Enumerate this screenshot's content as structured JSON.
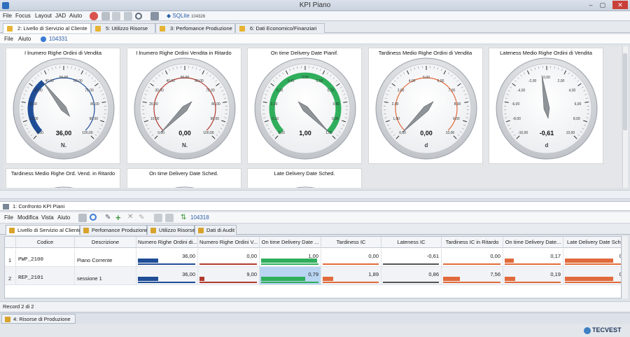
{
  "window": {
    "title": "KPI Piano",
    "min": "–",
    "max": "▢",
    "close": "✕"
  },
  "menubar": {
    "items": [
      "File",
      "Focus",
      "Layout",
      "JAD",
      "Aiuto"
    ],
    "db_label": "SQLite",
    "db_id": "104326"
  },
  "main_tabs": [
    {
      "label": "2: Livello di Servizio al Cliente",
      "active": true
    },
    {
      "label": "5: Utilizzo Risorse",
      "active": false
    },
    {
      "label": "3: Perfomance Produzione",
      "active": false
    },
    {
      "label": "6: Dati Economico/Finanziari",
      "active": false
    }
  ],
  "sub_menu": {
    "items": [
      "File",
      "Aiuto"
    ],
    "db_id": "104331"
  },
  "gauges": [
    {
      "title": "I lnumero Righe Ordini di Vendita",
      "value_text": "36,00",
      "unit": "N.",
      "min": 0,
      "max": 100,
      "value": 36,
      "ticks": [
        "0,00",
        "10,00",
        "20,00",
        "30,00",
        "40,00",
        "50,00",
        "60,00",
        "70,00",
        "80,00",
        "90,00",
        "100,00"
      ],
      "arc": {
        "from": 0,
        "to": 36,
        "color": "#1f4d96",
        "fill_band": true
      },
      "ring": {
        "from": 0,
        "to": 100,
        "color": "#1f4d96"
      }
    },
    {
      "title": "I lnumero Righe Ordini Vendita in Ritardo",
      "value_text": "0,00",
      "unit": "N.",
      "min": 0,
      "max": 100,
      "value": 0,
      "ticks": [
        "0,00",
        "10,00",
        "20,00",
        "30,00",
        "40,00",
        "50,00",
        "60,00",
        "70,00",
        "80,00",
        "90,00",
        "100,00"
      ],
      "arc": null,
      "ring": {
        "from": 0,
        "to": 100,
        "color": "#b03a2e"
      }
    },
    {
      "title": "On time Delivery Date Pianif.",
      "value_text": "1,00",
      "unit": "",
      "min": 0,
      "max": 1,
      "value": 1,
      "ticks": [
        "0,00",
        "0,10",
        "0,20",
        "0,30",
        "0,40",
        "0,50",
        "0,60",
        "0,70",
        "0,80",
        "0,90",
        "1,00"
      ],
      "arc": {
        "from": 0,
        "to": 1,
        "color": "#2fae5b",
        "fill_band": true
      },
      "ring": {
        "from": 0,
        "to": 1,
        "color": "#2fae5b"
      }
    },
    {
      "title": "Tardiness Medio Righe Ordini di Vendita",
      "value_text": "0,00",
      "unit": "d",
      "min": 0,
      "max": 10,
      "value": 0,
      "ticks": [
        "0,00",
        "1,00",
        "2,00",
        "3,00",
        "4,00",
        "5,00",
        "6,00",
        "7,00",
        "8,00",
        "9,00",
        "10,00"
      ],
      "arc": null,
      "ring": {
        "from": 0,
        "to": 10,
        "color": "#e06a3b"
      }
    },
    {
      "title": "Lateness Medio Righe Ordini di Vendita",
      "value_text": "-0,61",
      "unit": "d",
      "min": -10,
      "max": 10,
      "value": -0.61,
      "ticks": [
        "-10,00",
        "-8,00",
        "-6,00",
        "-4,00",
        "-2,00",
        "0,00",
        "2,00",
        "4,00",
        "6,00",
        "8,00",
        "10,00"
      ],
      "arc": null,
      "ring": null
    }
  ],
  "gauges_row2": [
    {
      "title": "Tardiness Medio Righe Ord. Vend. in Ritardo"
    },
    {
      "title": "On time Delivery Date Sched."
    },
    {
      "title": "Late Delivery Date Sched."
    }
  ],
  "lower": {
    "header": "1: Confronto KPI Piani",
    "menu": [
      "File",
      "Modifica",
      "Vista",
      "Aiuto"
    ],
    "db_id": "104318",
    "tabs": [
      {
        "label": "Livello di Servizio al Cliente",
        "active": true
      },
      {
        "label": "Perfomance Produzione",
        "active": false
      },
      {
        "label": "Utilizzo Risorse",
        "active": false
      },
      {
        "label": "Dati di Audit",
        "active": false
      }
    ],
    "columns": [
      "",
      "Codice",
      "Descrizione",
      "Numero Righe Ordini di...",
      "Numero Righe Ordini V...",
      "On time Delivery Date ...",
      "Tardiness IC",
      "Lateness IC",
      "Tardiness IC in Ritardo",
      "On time Delivery Date...",
      "Late Delivery Date Sch..."
    ],
    "rows": [
      {
        "n": "1",
        "codice": "PWP_2100",
        "descrizione": "Piano Corrente",
        "vals": [
          "36,00",
          "0,00",
          "1,00",
          "0,00",
          "-0,61",
          "0,00",
          "0,17",
          "0,8"
        ]
      },
      {
        "n": "2",
        "codice": "REP_2101",
        "descrizione": "sessione 1",
        "vals": [
          "36,00",
          "9,00",
          "0,79",
          "1,89",
          "0,86",
          "7,56",
          "0,19",
          "0,8"
        ]
      }
    ],
    "status": "Record 2 di 2",
    "bottom_tab": "4: Risorse di Produzione"
  },
  "brand": "TECVEST"
}
